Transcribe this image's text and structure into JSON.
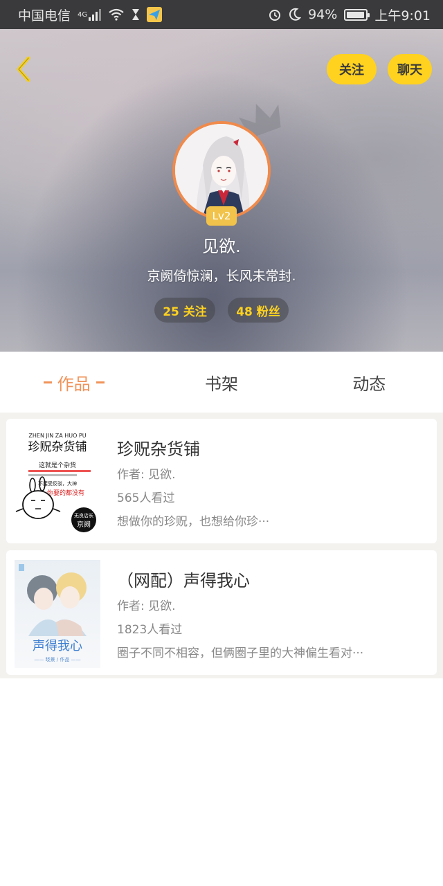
{
  "status_bar": {
    "carrier": "中国电信",
    "network": "4G",
    "battery": "94%",
    "battery_level": 0.94,
    "time": "上午9:01",
    "icons": [
      "signal-icon",
      "wifi-icon",
      "hourglass-icon",
      "send-app-icon",
      "alarm-icon",
      "moon-icon",
      "battery-icon"
    ]
  },
  "header": {
    "back_icon": "chevron-left-icon",
    "follow_label": "关注",
    "chat_label": "聊天",
    "level": "Lv2",
    "username": "见欲.",
    "signature": "京阙倚惊澜，长风未常封.",
    "following": "25 关注",
    "followers": "48 粉丝",
    "accent_color": "#ffd21f"
  },
  "tabs": [
    {
      "label": "作品",
      "active": true
    },
    {
      "label": "书架",
      "active": false
    },
    {
      "label": "动态",
      "active": false
    }
  ],
  "works": [
    {
      "title": "珍贶杂货铺",
      "author": "作者: 见欲.",
      "views": "565人看过",
      "description": "想做你的珍贶，也想给你珍···",
      "cover": {
        "pinyin": "ZHEN JIN ZA HUO PU",
        "title": "珍贶杂货铺",
        "line1": "这就是个杂货",
        "line2": "不接受反驳，大神",
        "line3": "你要的都没有",
        "badge_top": "无良店长",
        "badge_name": "京阙"
      }
    },
    {
      "title": "（网配）声得我心",
      "author": "作者: 见欲.",
      "views": "1823人看过",
      "description": "圈子不同不相容，但俩圈子里的大神偏生看对···",
      "cover": {
        "title": "声得我心",
        "subtitle": "—— 晓景 / 作品 ——"
      }
    }
  ]
}
